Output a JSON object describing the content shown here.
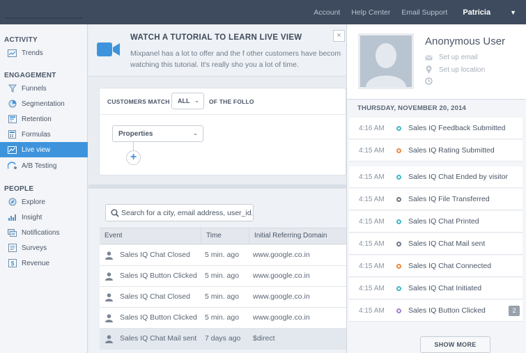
{
  "topbar": {
    "links": [
      "Account",
      "Help Center",
      "Email Support"
    ],
    "user": "Patricia"
  },
  "sidebar": {
    "sections": [
      {
        "title": "ACTIVITY",
        "items": [
          {
            "label": "Trends",
            "icon": "trends-icon"
          }
        ]
      },
      {
        "title": "ENGAGEMENT",
        "items": [
          {
            "label": "Funnels",
            "icon": "funnel-icon"
          },
          {
            "label": "Segmentation",
            "icon": "pie-chart-icon"
          },
          {
            "label": "Retention",
            "icon": "retention-icon"
          },
          {
            "label": "Formulas",
            "icon": "calculator-icon"
          },
          {
            "label": "Live view",
            "icon": "live-view-icon",
            "active": true
          },
          {
            "label": "A/B Testing",
            "icon": "ab-testing-icon"
          }
        ]
      },
      {
        "title": "PEOPLE",
        "items": [
          {
            "label": "Explore",
            "icon": "explore-icon"
          },
          {
            "label": "Insight",
            "icon": "insight-icon"
          },
          {
            "label": "Notifications",
            "icon": "notifications-icon"
          },
          {
            "label": "Surveys",
            "icon": "surveys-icon"
          },
          {
            "label": "Revenue",
            "icon": "revenue-icon"
          }
        ]
      }
    ]
  },
  "tutorial": {
    "title": "WATCH A TUTORIAL TO LEARN  LIVE VIEW",
    "line1": "Mixpanel has a lot to offer and the f other customers have becom",
    "line2": "watching this tutorial. It's really sho  you a lot of time.",
    "close": "×"
  },
  "filter": {
    "customers_match": "CUSTOMERS MATCH",
    "match_value": "ALL",
    "of_the_following": "OF THE FOLLO",
    "properties": "Properties",
    "add": "+"
  },
  "events": {
    "search_placeholder": "Search for a city, email address, user_id,",
    "columns": [
      "Event",
      "Time",
      "Initial Referring Domain"
    ],
    "rows": [
      {
        "event": "Sales IQ Chat Closed",
        "time": "5 min. ago",
        "domain": "www.google.co.in"
      },
      {
        "event": "Sales IQ Button Clicked",
        "time": "5 min. ago",
        "domain": "www.google.co.in"
      },
      {
        "event": "Sales IQ Chat Closed",
        "time": "5 min. ago",
        "domain": "www.google.co.in"
      },
      {
        "event": "Sales IQ Button Clicked",
        "time": "5 min. ago",
        "domain": "www.google.co.in"
      },
      {
        "event": "Sales IQ Chat Mail sent",
        "time": "7 days ago",
        "domain": "$direct",
        "highlight": true
      }
    ]
  },
  "profile": {
    "name": "Anonymous User",
    "email": "Set up email",
    "location": "Set up location"
  },
  "activity": {
    "date": "THURSDAY, NOVEMBER 20, 2014",
    "items": [
      {
        "time": "4:16 AM",
        "name": "Sales IQ Feedback Submitted",
        "color": "#3fb8c9"
      },
      {
        "time": "4:15 AM",
        "name": "Sales IQ Rating Submitted",
        "color": "#ef8a3f"
      },
      {
        "time": "4:15 AM",
        "name": "Sales IQ Chat Ended by visitor",
        "color": "#3fb8c9"
      },
      {
        "time": "4:15 AM",
        "name": "Sales IQ File Transferred",
        "color": "#6b7685"
      },
      {
        "time": "4:15 AM",
        "name": "Sales IQ Chat Printed",
        "color": "#3fb8c9"
      },
      {
        "time": "4:15 AM",
        "name": "Sales IQ Chat Mail sent",
        "color": "#6b7685"
      },
      {
        "time": "4:15 AM",
        "name": "Sales IQ Chat Connected",
        "color": "#ef8a3f"
      },
      {
        "time": "4:15 AM",
        "name": "Sales IQ Chat Initiated",
        "color": "#3fb8c9"
      },
      {
        "time": "4:15 AM",
        "name": "Sales IQ Button Clicked",
        "color": "#a77fd0",
        "badge": "2"
      }
    ],
    "show_more": "SHOW MORE"
  }
}
